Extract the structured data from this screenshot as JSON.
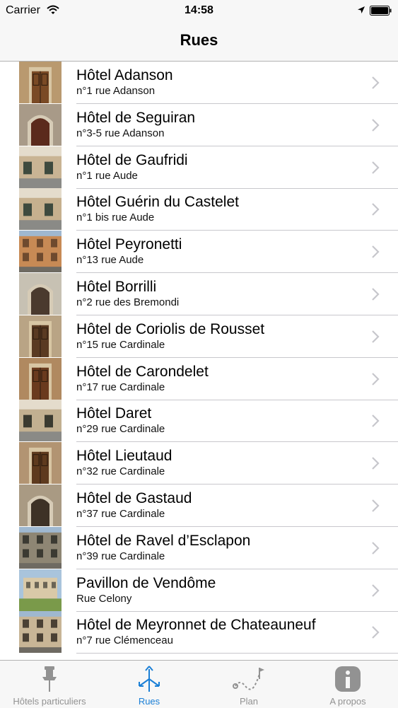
{
  "status_bar": {
    "carrier": "Carrier",
    "time": "14:58"
  },
  "nav": {
    "title": "Rues"
  },
  "rows": [
    {
      "name": "Hôtel Adanson",
      "address": "n°1  rue Adanson",
      "img": "door",
      "c1": "#b9996f",
      "c2": "#7a4a25"
    },
    {
      "name": "Hôtel de Seguiran",
      "address": "n°3-5 rue Adanson",
      "img": "arch",
      "c1": "#a89a88",
      "c2": "#5b2a1c"
    },
    {
      "name": "Hôtel de Gaufridi",
      "address": "n°1 rue Aude",
      "img": "facade",
      "c1": "#c9b494",
      "c2": "#3e4a3e"
    },
    {
      "name": "Hôtel Guérin du Castelet",
      "address": "n°1 bis rue Aude",
      "img": "facade",
      "c1": "#c6b08e",
      "c2": "#3e4a3e"
    },
    {
      "name": "Hôtel Peyronetti",
      "address": "n°13 rue Aude",
      "img": "building",
      "c1": "#c78a55",
      "c2": "#6e4a2e"
    },
    {
      "name": "Hôtel Borrilli",
      "address": "n°2 rue des Bremondi",
      "img": "arch",
      "c1": "#c7c1b3",
      "c2": "#4a3a2e"
    },
    {
      "name": "Hôtel de Coriolis de Rousset",
      "address": "n°15 rue Cardinale",
      "img": "door",
      "c1": "#b9a485",
      "c2": "#5a3a22"
    },
    {
      "name": "Hôtel de Carondelet",
      "address": "n°17 rue Cardinale",
      "img": "door",
      "c1": "#b08960",
      "c2": "#6a3a1e"
    },
    {
      "name": "Hôtel Daret",
      "address": "n°29 rue Cardinale",
      "img": "facade",
      "c1": "#c2b091",
      "c2": "#3a3a30"
    },
    {
      "name": "Hôtel Lieutaud",
      "address": "n°32 rue Cardinale",
      "img": "door",
      "c1": "#b29472",
      "c2": "#5e3a1e"
    },
    {
      "name": "Hôtel de Gastaud",
      "address": "n°37 rue Cardinale",
      "img": "arch",
      "c1": "#a99a83",
      "c2": "#3e3226"
    },
    {
      "name": "Hôtel de Ravel d’Esclapon",
      "address": "n°39 rue Cardinale",
      "img": "building",
      "c1": "#8e8674",
      "c2": "#3b3a32"
    },
    {
      "name": "Pavillon de Vendôme",
      "address": "Rue Celony",
      "img": "pavilion",
      "c1": "#d9c9a8",
      "c2": "#7a9a4a"
    },
    {
      "name": "Hôtel de Meyronnet de Chateauneuf",
      "address": "n°7 rue Clémenceau",
      "img": "building",
      "c1": "#c8b596",
      "c2": "#4a4034"
    }
  ],
  "tabs": [
    {
      "label": "Hôtels particuliers",
      "icon": "pin-icon",
      "active": false
    },
    {
      "label": "Rues",
      "icon": "signpost-icon",
      "active": true
    },
    {
      "label": "Plan",
      "icon": "route-icon",
      "active": false
    },
    {
      "label": "A propos",
      "icon": "info-icon",
      "active": false
    }
  ],
  "colors": {
    "accent": "#1a7fd6",
    "inactive_tab": "#929292",
    "chevron": "#c7c7cc",
    "separator": "#c8c7cc"
  }
}
